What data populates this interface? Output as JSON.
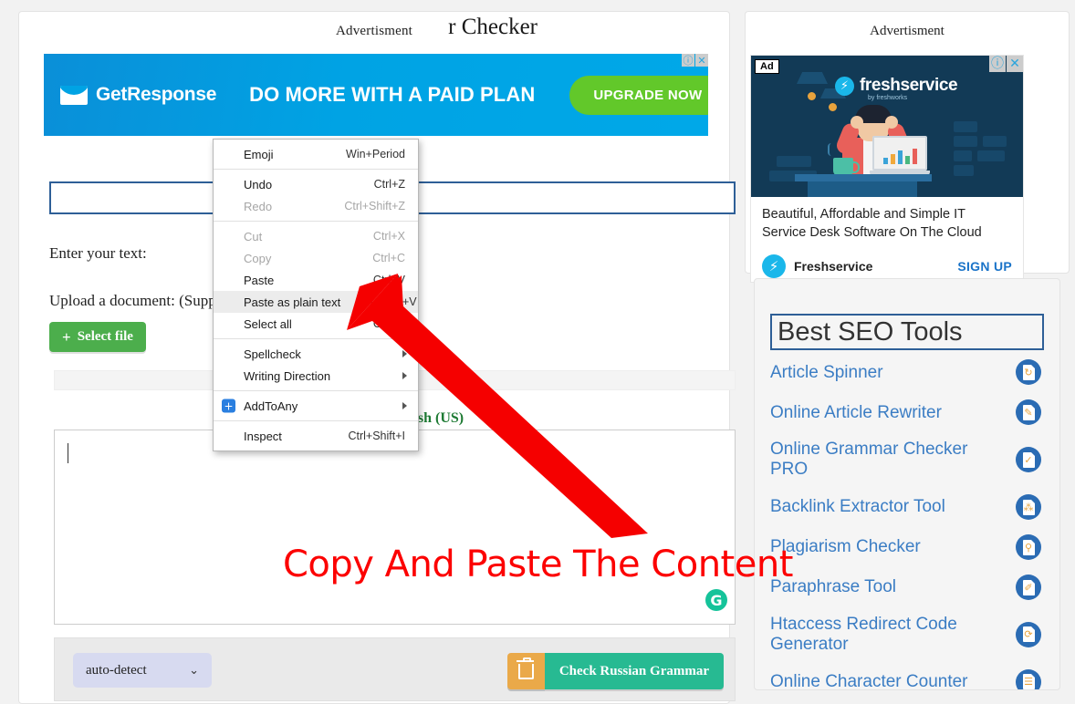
{
  "main": {
    "ad_label": "Advertisment",
    "banner_ad": {
      "brand": "GetResponse",
      "headline": "DO MORE WITH A PAID PLAN",
      "cta": "UPGRADE NOW",
      "info_icon": "ⓘ",
      "close_icon": "✕",
      "bg_color": "#00a3e4",
      "cta_color": "#62c82a"
    },
    "title": "r Checker",
    "enter_text_label": "Enter your text:",
    "upload_label": "Upload a document: (Supporte",
    "select_file_button": "Select file",
    "select_file_plus": "+",
    "language_note": "glish (US)",
    "grammarly_icon": "G",
    "toolbar": {
      "language_value": "auto-detect",
      "chevron": "⌄",
      "clear_icon": "trash-icon",
      "check_button": "Check Russian Grammar",
      "check_color": "#27ba92",
      "clear_color": "#eaa949"
    }
  },
  "context_menu": {
    "items": [
      {
        "label": "Emoji",
        "key": "Win+Period",
        "disabled": false,
        "highlight": false,
        "submenu": false,
        "sep_after": true
      },
      {
        "label": "Undo",
        "key": "Ctrl+Z",
        "disabled": false,
        "highlight": false,
        "submenu": false,
        "sep_after": false
      },
      {
        "label": "Redo",
        "key": "Ctrl+Shift+Z",
        "disabled": true,
        "highlight": false,
        "submenu": false,
        "sep_after": true
      },
      {
        "label": "Cut",
        "key": "Ctrl+X",
        "disabled": true,
        "highlight": false,
        "submenu": false,
        "sep_after": false
      },
      {
        "label": "Copy",
        "key": "Ctrl+C",
        "disabled": true,
        "highlight": false,
        "submenu": false,
        "sep_after": false
      },
      {
        "label": "Paste",
        "key": "Ctrl+V",
        "disabled": false,
        "highlight": false,
        "submenu": false,
        "sep_after": false
      },
      {
        "label": "Paste as plain text",
        "key": "Ctrl+Shift+V",
        "disabled": false,
        "highlight": true,
        "submenu": false,
        "sep_after": false
      },
      {
        "label": "Select all",
        "key": "Ctrl+A",
        "disabled": false,
        "highlight": false,
        "submenu": false,
        "sep_after": true
      },
      {
        "label": "Spellcheck",
        "key": "",
        "disabled": false,
        "highlight": false,
        "submenu": true,
        "sep_after": false
      },
      {
        "label": "Writing Direction",
        "key": "",
        "disabled": false,
        "highlight": false,
        "submenu": true,
        "sep_after": true
      },
      {
        "label": "AddToAny",
        "key": "",
        "disabled": false,
        "highlight": false,
        "submenu": true,
        "sep_after": true,
        "icon": "addtoany-icon"
      },
      {
        "label": "Inspect",
        "key": "Ctrl+Shift+I",
        "disabled": false,
        "highlight": false,
        "submenu": false,
        "sep_after": false
      }
    ]
  },
  "annotation": {
    "text": "Copy And Paste The Content",
    "color": "#fc0000"
  },
  "sidebar": {
    "ad_label": "Advertisment",
    "ad": {
      "badge": "Ad",
      "info_icon": "ⓘ",
      "close_icon": "✕",
      "logo_text": "freshservice",
      "logo_sub": "by freshworks",
      "bolt_icon": "⚡",
      "description": "Beautiful, Affordable and Simple IT Service Desk Software On The Cloud",
      "brand": "Freshservice",
      "signup": "SIGN UP",
      "accent_color": "#1ab7ea",
      "hero_bg": "#123a56"
    },
    "seo_title": "Best SEO Tools",
    "seo_items": [
      {
        "label": "Article Spinner",
        "icon": "article-spinner-icon",
        "glyph": "↻"
      },
      {
        "label": "Online Article Rewriter",
        "icon": "article-rewriter-icon",
        "glyph": "✎"
      },
      {
        "label": "Online Grammar Checker PRO",
        "icon": "grammar-checker-icon",
        "glyph": "✓"
      },
      {
        "label": "Backlink Extractor Tool",
        "icon": "backlink-extractor-icon",
        "glyph": "⁂"
      },
      {
        "label": "Plagiarism Checker",
        "icon": "plagiarism-checker-icon",
        "glyph": "⚲"
      },
      {
        "label": "Paraphrase Tool",
        "icon": "paraphrase-tool-icon",
        "glyph": "✐"
      },
      {
        "label": "Htaccess Redirect Code Generator",
        "icon": "htaccess-redirect-icon",
        "glyph": "⟳"
      },
      {
        "label": "Online Character Counter",
        "icon": "character-counter-icon",
        "glyph": "☰"
      }
    ]
  }
}
